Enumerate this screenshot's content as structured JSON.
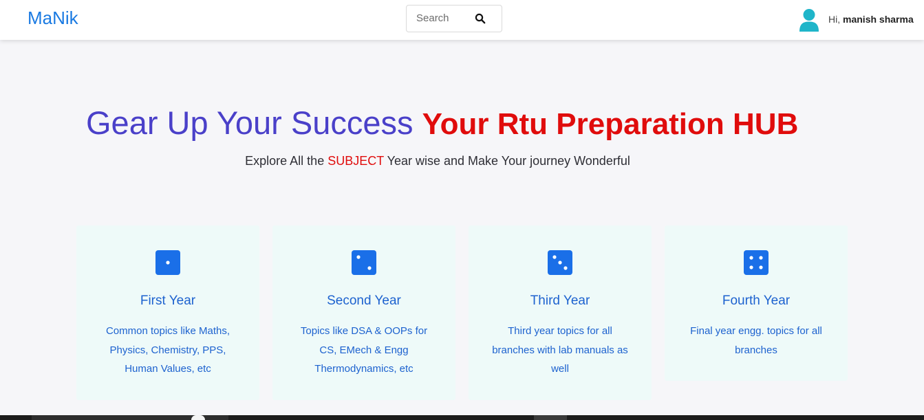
{
  "navbar": {
    "brand": "MaNik",
    "search": {
      "placeholder": "Search",
      "icon": "search-icon"
    },
    "user": {
      "greeting": "Hi,",
      "name": "manish sharma",
      "icon": "user-avatar-icon"
    }
  },
  "hero": {
    "title_part1": "Gear Up Your Success",
    "title_part2": "Your Rtu Preparation HUB",
    "subtitle_before": "Explore All the",
    "subtitle_highlight": "SUBJECT",
    "subtitle_after": "Year wise and Make Your journey Wonderful"
  },
  "cards": [
    {
      "icon": "dice-one-icon",
      "title": "First Year",
      "description": "Common topics like Maths, Physics, Chemistry, PPS, Human Values, etc"
    },
    {
      "icon": "dice-two-icon",
      "title": "Second Year",
      "description": "Topics like DSA & OOPs for CS, EMech & Engg Thermodynamics, etc"
    },
    {
      "icon": "dice-three-icon",
      "title": "Third Year",
      "description": "Third year topics for all branches with lab manuals as well"
    },
    {
      "icon": "dice-four-icon",
      "title": "Fourth Year",
      "description": "Final year engg. topics for all branches"
    }
  ],
  "colors": {
    "brand": "#1a7ae2",
    "title_primary": "#4a40c9",
    "highlight_red": "#e00c0c",
    "card_background": "#eefaf9",
    "card_text": "#1d62cf",
    "icon_blue": "#1a6fe8",
    "avatar": "#1fb5c9"
  }
}
